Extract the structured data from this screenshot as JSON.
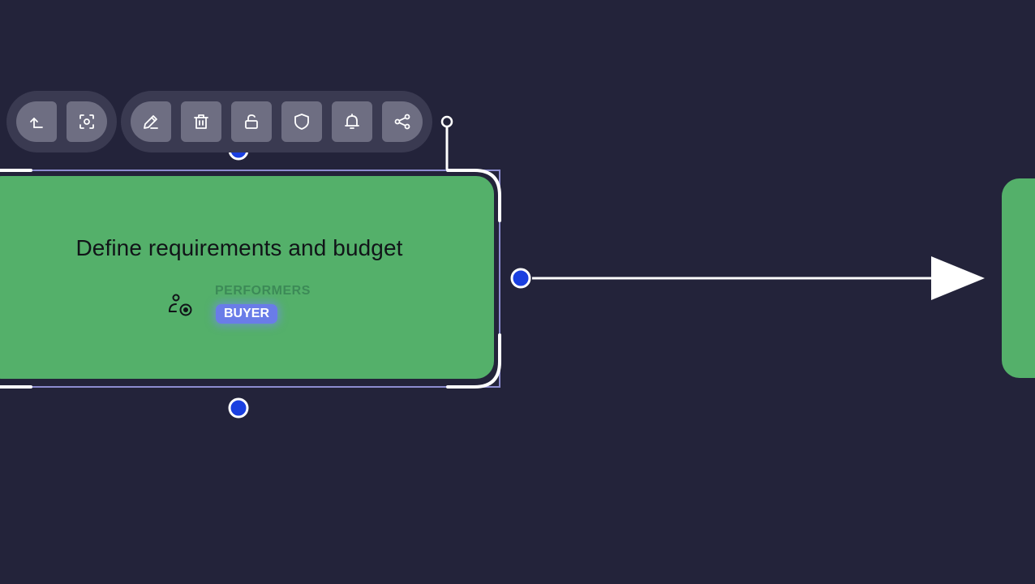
{
  "toolbar_left": {
    "items": [
      {
        "id": "parent",
        "icon": "arrow-up-left-icon"
      },
      {
        "id": "focus",
        "icon": "focus-icon"
      }
    ]
  },
  "toolbar_right": {
    "items": [
      {
        "id": "edit",
        "icon": "pencil-icon"
      },
      {
        "id": "delete",
        "icon": "trash-icon"
      },
      {
        "id": "unlock",
        "icon": "unlock-icon"
      },
      {
        "id": "shield",
        "icon": "shield-icon"
      },
      {
        "id": "notifications",
        "icon": "bell-icon"
      },
      {
        "id": "share",
        "icon": "share-icon"
      }
    ]
  },
  "node": {
    "title": "Define requirements and budget",
    "performers_label": "PERFORMERS",
    "role": "BUYER",
    "color": "#54b06a"
  },
  "colors": {
    "canvas": "#23233a",
    "handle": "#1a3fe0",
    "selection": "#8c8ccf",
    "badge": "#6a7ce8"
  }
}
